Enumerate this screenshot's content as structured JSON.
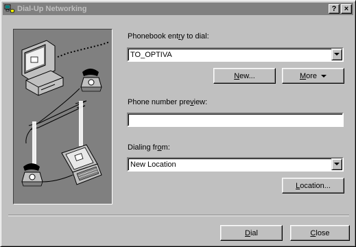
{
  "window": {
    "title": "Dial-Up Networking",
    "help_glyph": "?",
    "close_glyph": "×"
  },
  "phonebook": {
    "label_pre": "Phonebook ent",
    "label_accel": "r",
    "label_post": "y to dial:",
    "value": "TO_OPTIVA"
  },
  "buttons": {
    "new_accel": "N",
    "new_rest": "ew...",
    "more_accel": "M",
    "more_rest": "ore",
    "location_accel": "L",
    "location_rest": "ocation...",
    "dial_accel": "D",
    "dial_rest": "ial",
    "close_accel": "C",
    "close_rest": "lose"
  },
  "preview": {
    "label_pre": "Phone number pre",
    "label_accel": "v",
    "label_post": "iew:",
    "value": ""
  },
  "dialing_from": {
    "label_pre": "Dialing fr",
    "label_accel": "o",
    "label_post": "m:",
    "value": "New Location"
  },
  "icons": {
    "title": "dial-up-networking-icon",
    "dropdown": "triangle-down",
    "illustration": "computer-phone-telephone-pole-laptop"
  },
  "colors": {
    "face": "#c0c0c0",
    "shadow": "#808080",
    "highlight": "#ffffff",
    "inactive_title": "#808080"
  }
}
